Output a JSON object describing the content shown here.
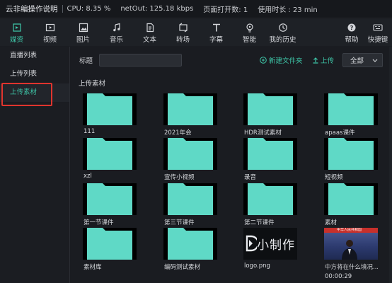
{
  "status_bar": {
    "app_title": "云非编操作说明",
    "cpu": "CPU: 8.35 %",
    "net": "netOut: 125.18 kbps",
    "pages_open": "页面打开数: 1",
    "duration": "使用时长 : 23 min"
  },
  "toolbar": {
    "items": [
      {
        "label": "媒资",
        "icon": "media-icon",
        "active": true
      },
      {
        "label": "视频",
        "icon": "video-icon"
      },
      {
        "label": "图片",
        "icon": "image-icon"
      },
      {
        "label": "音乐",
        "icon": "music-icon"
      },
      {
        "label": "文本",
        "icon": "text-doc-icon"
      },
      {
        "label": "转场",
        "icon": "transition-icon"
      },
      {
        "label": "字幕",
        "icon": "subtitle-icon"
      },
      {
        "label": "智能",
        "icon": "smart-icon"
      },
      {
        "label": "我的历史",
        "icon": "history-icon"
      }
    ],
    "right_items": [
      {
        "label": "帮助",
        "icon": "help-icon"
      },
      {
        "label": "快捷键",
        "icon": "keyboard-icon"
      }
    ],
    "accent_color": "#3ec6a8"
  },
  "sidebar": {
    "items": [
      {
        "label": "直播列表"
      },
      {
        "label": "上传列表"
      },
      {
        "label": "上传素材",
        "active": true
      }
    ]
  },
  "filter": {
    "title_label": "标题",
    "title_value": "",
    "new_folder_label": "新建文件夹",
    "upload_label": "上传",
    "select_value": "全部"
  },
  "section": {
    "title": "上传素材"
  },
  "tiles": [
    {
      "name": "111",
      "type": "folder"
    },
    {
      "name": "2021年会",
      "type": "folder"
    },
    {
      "name": "HDR测试素材",
      "type": "folder"
    },
    {
      "name": "apaas课件",
      "type": "folder"
    },
    {
      "name": "xzl",
      "type": "folder"
    },
    {
      "name": "宣传小视频",
      "type": "folder"
    },
    {
      "name": "录音",
      "type": "folder"
    },
    {
      "name": "短视频",
      "type": "folder"
    },
    {
      "name": "第一节课件",
      "type": "folder"
    },
    {
      "name": "第三节课件",
      "type": "folder"
    },
    {
      "name": "第二节课件",
      "type": "folder"
    },
    {
      "name": "素材",
      "type": "folder"
    },
    {
      "name": "素材库",
      "type": "folder"
    },
    {
      "name": "编码测试素材",
      "type": "folder"
    },
    {
      "name": "logo.png",
      "type": "image",
      "logo_text": "小制作"
    },
    {
      "name": "中方将在什么境况...",
      "type": "video",
      "duration": "00:00:29",
      "banner_text": "中华人民共和国"
    }
  ],
  "colors": {
    "folder": "#5fd9c6",
    "accent": "#3ec6a8",
    "highlight_border": "#e0342e"
  }
}
